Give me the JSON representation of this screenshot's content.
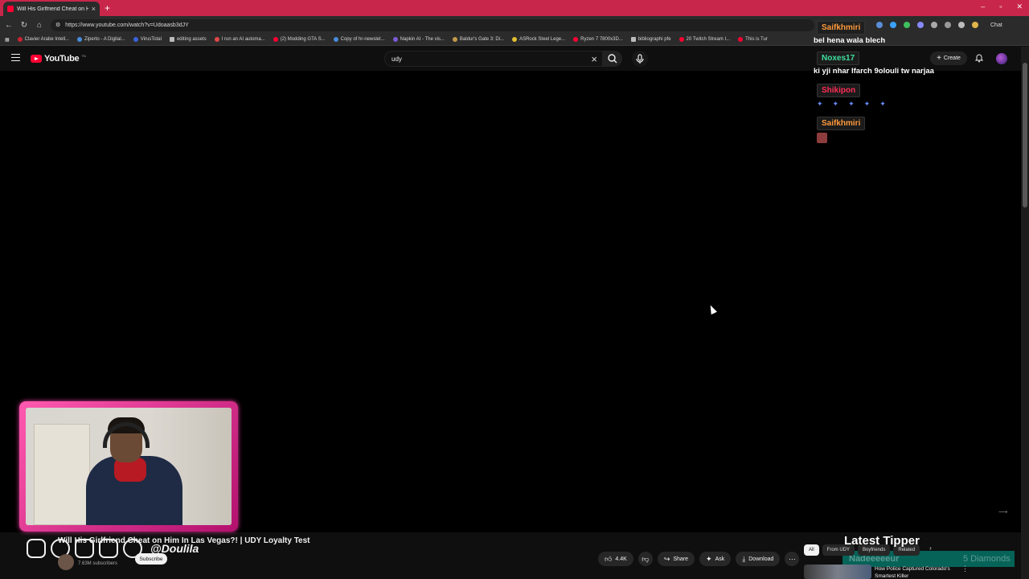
{
  "browser": {
    "tab_title": "Will His Girlfriend Cheat on Hi",
    "url": "https://www.youtube.com/watch?v=Udoaasb3dJY",
    "chat_label": "Chat",
    "bookmarks": [
      "Clavier Arabe Intell...",
      "Ziperto - A Digital...",
      "VirusTotal",
      "editing assets",
      "I run an AI automa...",
      "(2) Modding GTA S...",
      "Copy of hr-newslet...",
      "Napkin AI - The vis...",
      "Baldur's Gate 3: Di...",
      "ASRock Steel Lege...",
      "Ryzen 7 7800x3D...",
      "bibliographi pfe",
      "20 Twitch Stream I...",
      "This is Tur"
    ]
  },
  "youtube": {
    "logo_text": "YouTube",
    "logo_tn": "TN",
    "search_value": "udy",
    "create_label": "Create"
  },
  "chat": [
    {
      "user": "Saifkhmiri",
      "color": "#ff9a3c",
      "text": "bel hena wala blech"
    },
    {
      "user": "Noxes17",
      "color": "#3fe0a0",
      "text": "ki yji nhar lfarch 9olouli tw narjaa"
    },
    {
      "user": "Shikipon",
      "color": "#ff2d55",
      "text": "",
      "emotes": [
        "emote-1",
        "emote-2",
        "emote-3",
        "emote-4",
        "emote-5"
      ]
    },
    {
      "user": "Saifkhmiri",
      "color": "#ff9a3c",
      "text": "",
      "image_emote": true
    }
  ],
  "video": {
    "title": "Will His Girlfriend Cheat on Him In Las Vegas?! | UDY Loyalty Test",
    "subscribers": "7.63M subscribers",
    "subscribe_label": "Subscribe",
    "social_handle": "@Doulila",
    "likes": "4.4K",
    "share_label": "Share",
    "ask_label": "Ask",
    "download_label": "Download"
  },
  "sidebar": {
    "chips": [
      "All",
      "From UDY",
      "Boyfriends",
      "Related"
    ],
    "latest_tipper_label": "Latest Tipper",
    "tipper_name": "Nadeeeeeur",
    "tipper_amount": "5 Diamonds",
    "related_title": "How Police Captured Colorado's Smartest Killer"
  }
}
